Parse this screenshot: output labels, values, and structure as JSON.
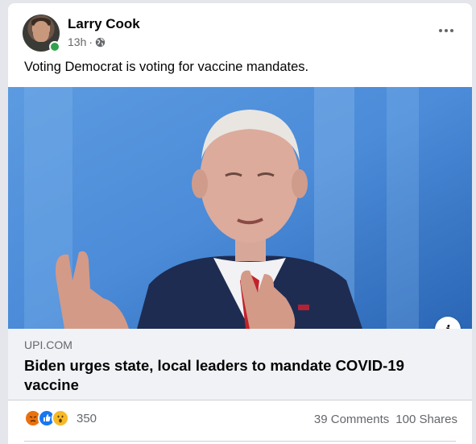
{
  "post": {
    "author": "Larry Cook",
    "time": "13h",
    "visibility_icon": "globe-icon",
    "text": "Voting Democrat is voting for vaccine mandates."
  },
  "link": {
    "domain": "UPI.COM",
    "headline": "Biden urges state, local leaders to mandate COVID-19 vaccine",
    "info_label": "i"
  },
  "engagement": {
    "reaction_icons": [
      "angry-reaction-icon",
      "like-reaction-icon",
      "wow-reaction-icon"
    ],
    "reaction_count": "350",
    "comments": "39 Comments",
    "shares": "100 Shares"
  },
  "colors": {
    "online": "#31a24c",
    "like": "#1877f2",
    "angry": "#e9710f",
    "wow": "#f7b928"
  }
}
